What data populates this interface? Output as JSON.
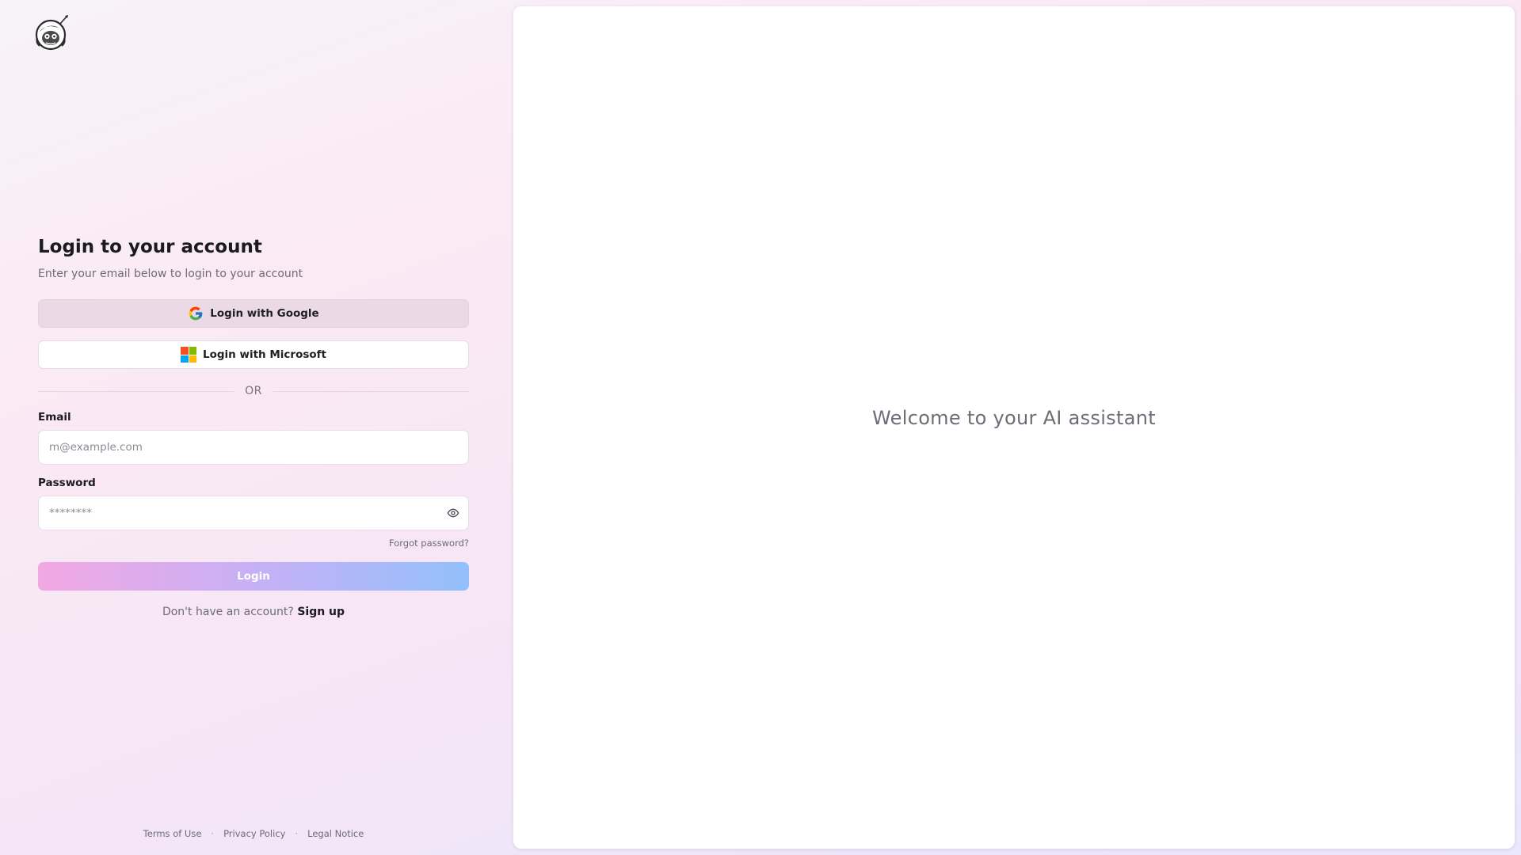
{
  "login": {
    "title": "Login to your account",
    "subtitle": "Enter your email below to login to your account",
    "google_label": "Login with Google",
    "microsoft_label": "Login with Microsoft",
    "divider_text": "OR",
    "email_label": "Email",
    "email_placeholder": "m@example.com",
    "email_value": "",
    "password_label": "Password",
    "password_placeholder": "********",
    "password_value": "",
    "forgot_label": "Forgot password?",
    "submit_label": "Login",
    "signup_prompt": "Don't have an account?",
    "signup_label": "Sign up"
  },
  "footer": {
    "links": [
      "Terms of Use",
      "Privacy Policy",
      "Legal Notice"
    ],
    "separator": "·"
  },
  "main": {
    "welcome_text": "Welcome to your AI assistant"
  },
  "icons": {
    "logo": "astronaut-logo-icon",
    "google": "google-icon",
    "microsoft": "microsoft-icon",
    "password_toggle": "eye-icon"
  },
  "colors": {
    "login_gradient_start": "#f2a8e3",
    "login_gradient_end": "#93c0fb",
    "google_button_bg": "#ecd9e6",
    "microsoft_red": "#f25022",
    "microsoft_green": "#7fba00",
    "microsoft_blue": "#00a4ef",
    "microsoft_yellow": "#ffb900"
  }
}
